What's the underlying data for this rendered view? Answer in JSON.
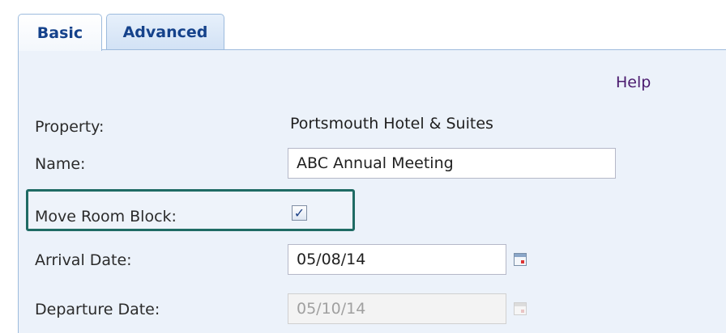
{
  "tabs": {
    "basic": "Basic",
    "advanced": "Advanced"
  },
  "help": "Help",
  "fields": {
    "property": {
      "label": "Property:",
      "value": "Portsmouth Hotel & Suites"
    },
    "name": {
      "label": "Name:",
      "value": "ABC Annual Meeting"
    },
    "move_room_block": {
      "label": "Move Room Block:",
      "checked": true,
      "check_glyph": "✓"
    },
    "arrival_date": {
      "label": "Arrival Date:",
      "value": "05/08/14"
    },
    "departure_date": {
      "label": "Departure Date:",
      "value": "05/10/14"
    }
  },
  "colors": {
    "tab_text": "#15428b",
    "panel_bg": "#ecf2fa",
    "highlight_border": "#1f6b64",
    "help_link": "#4a1a6e"
  },
  "icons": {
    "arrival_calendar": "calendar-icon",
    "departure_calendar": "calendar-icon"
  }
}
